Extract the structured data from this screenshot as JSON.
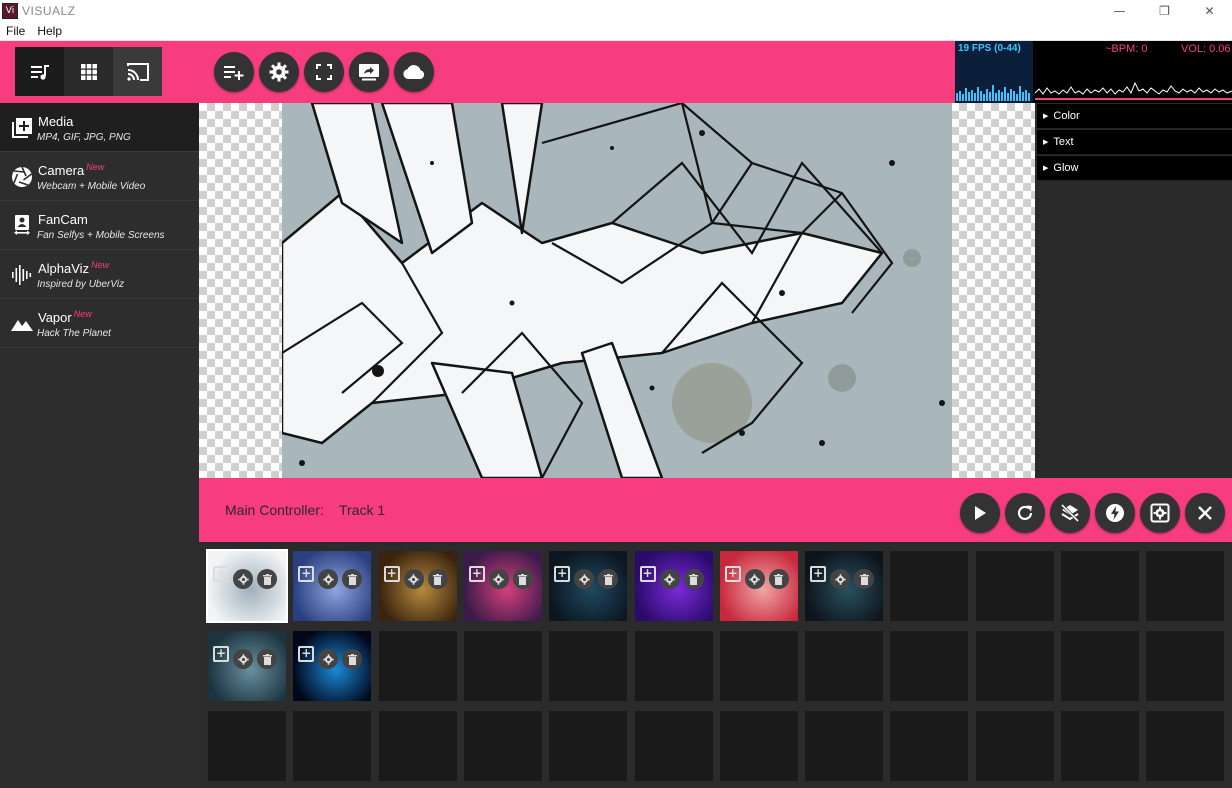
{
  "window": {
    "logo": "Vi",
    "title": "VISUALZ",
    "controls": {
      "minimize": "—",
      "restore": "❐",
      "close": "✕"
    }
  },
  "menu": {
    "file": "File",
    "help": "Help"
  },
  "view_toggle": [
    {
      "icon": "playlist-icon",
      "active": true
    },
    {
      "icon": "grid-icon",
      "active": false
    },
    {
      "icon": "cast-icon",
      "active": false
    }
  ],
  "toolbar": [
    {
      "icon": "add-playlist-icon"
    },
    {
      "icon": "gear-icon"
    },
    {
      "icon": "fullscreen-icon"
    },
    {
      "icon": "screen-share-icon"
    },
    {
      "icon": "cloud-icon"
    }
  ],
  "monitor": {
    "fps": "19 FPS (0-44)",
    "bpm": "~BPM: 0",
    "vol": "VOL: 0.06"
  },
  "sidebar": {
    "items": [
      {
        "label": "Media",
        "new": "",
        "sub": "MP4, GIF, JPG, PNG",
        "icon": "add-media-icon"
      },
      {
        "label": "Camera",
        "new": "New",
        "sub": "Webcam + Mobile Video",
        "icon": "camera-shutter-icon"
      },
      {
        "label": "FanCam",
        "new": "",
        "sub": "Fan Selfys + Mobile Screens",
        "icon": "fancam-icon"
      },
      {
        "label": "AlphaViz",
        "new": "New",
        "sub": "Inspired by UberViz",
        "icon": "audio-bars-icon"
      },
      {
        "label": "Vapor",
        "new": "New",
        "sub": "Hack The Planet",
        "icon": "mountain-icon"
      }
    ]
  },
  "properties": {
    "sections": [
      "Color",
      "Text",
      "Glow"
    ]
  },
  "controller": {
    "label": "Main Controller:",
    "track": "Track 1",
    "buttons": [
      {
        "icon": "play-icon"
      },
      {
        "icon": "refresh-icon"
      },
      {
        "icon": "layers-off-icon"
      },
      {
        "icon": "flash-icon"
      },
      {
        "icon": "settings-box-icon"
      },
      {
        "icon": "close-icon"
      }
    ]
  },
  "clips": {
    "add_glyph": "+",
    "items": [
      {
        "name": "clip-1",
        "selected": true,
        "colors": [
          "#f2f4f6",
          "#9fb0bb"
        ]
      },
      {
        "name": "clip-2",
        "selected": false,
        "colors": [
          "#2a3f80",
          "#8fa6e0"
        ]
      },
      {
        "name": "clip-3",
        "selected": false,
        "colors": [
          "#3a2410",
          "#b88a3c"
        ]
      },
      {
        "name": "clip-4",
        "selected": false,
        "colors": [
          "#3c1a4c",
          "#d4407a"
        ]
      },
      {
        "name": "clip-5",
        "selected": false,
        "colors": [
          "#0b1620",
          "#1f4a60"
        ]
      },
      {
        "name": "clip-6",
        "selected": false,
        "colors": [
          "#2a0b6a",
          "#7a2ad8"
        ]
      },
      {
        "name": "clip-7",
        "selected": false,
        "colors": [
          "#c8283c",
          "#f0a6a6"
        ]
      },
      {
        "name": "clip-8",
        "selected": false,
        "colors": [
          "#0d141c",
          "#2a5060"
        ]
      },
      {
        "name": "clip-9",
        "selected": false,
        "colors": [
          "#1c3440",
          "#6a90a0"
        ]
      },
      {
        "name": "clip-10",
        "selected": false,
        "colors": [
          "#02061a",
          "#1a8ad8"
        ]
      }
    ]
  },
  "colors": {
    "accent": "#f73d7e",
    "dark": "#2d2d2d",
    "fps": "#3ec3ff"
  }
}
